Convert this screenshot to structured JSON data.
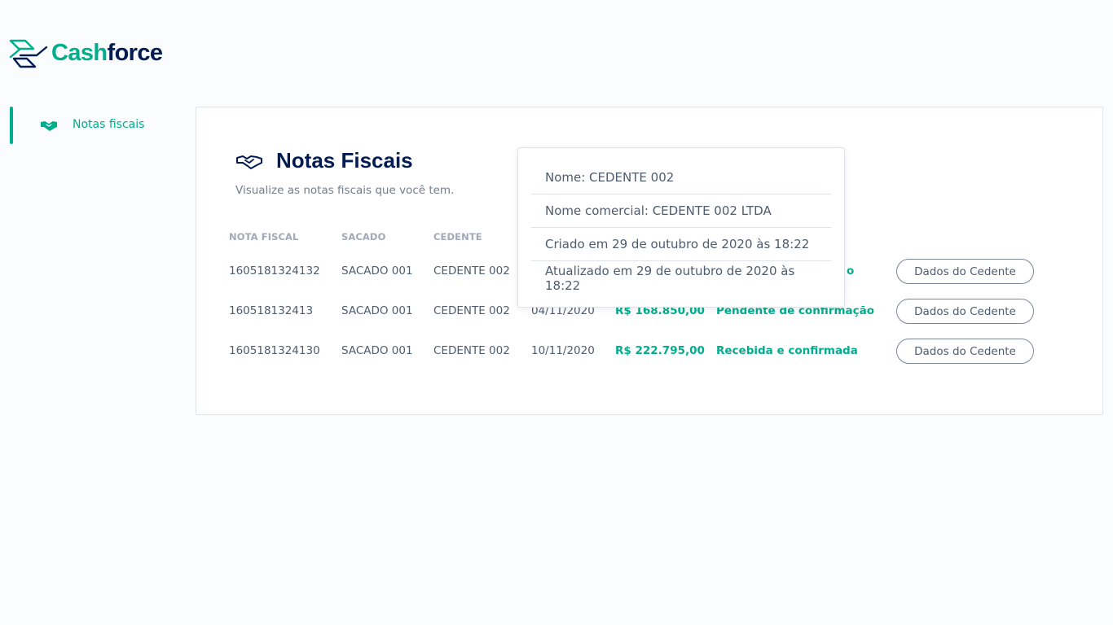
{
  "brand": {
    "name_part1": "Cash",
    "name_part2": "force"
  },
  "sidebar": {
    "items": [
      {
        "label": "Notas fiscais",
        "icon": "handshake-icon",
        "active": true
      }
    ]
  },
  "page": {
    "title": "Notas Fiscais",
    "subtitle": "Visualize as notas fiscais que você tem."
  },
  "table": {
    "headers": [
      "NOTA FISCAL",
      "SACADO",
      "CEDENTE"
    ],
    "rows": [
      {
        "nota": "1605181324132",
        "sacado": "SACADO 001",
        "cedente": "CEDENTE 002",
        "data": "",
        "valor": "",
        "status": "o",
        "action": "Dados do Cedente"
      },
      {
        "nota": "160518132413",
        "sacado": "SACADO 001",
        "cedente": "CEDENTE 002",
        "data": "04/11/2020",
        "valor": "R$ 168.850,00",
        "status": "Pendente de confirmação",
        "action": "Dados do Cedente"
      },
      {
        "nota": "1605181324130",
        "sacado": "SACADO 001",
        "cedente": "CEDENTE 002",
        "data": "10/11/2020",
        "valor": "R$ 222.795,00",
        "status": "Recebida e confirmada",
        "action": "Dados do Cedente"
      }
    ]
  },
  "popover": {
    "lines": [
      "Nome: CEDENTE 002",
      "Nome comercial: CEDENTE 002 LTDA",
      "Criado em 29 de outubro de 2020 às 18:22",
      "Atualizado em 29 de outubro de 2020 às 18:22"
    ]
  },
  "colors": {
    "accent": "#00ad8c",
    "navy": "#021b51",
    "text": "#4d5c6f",
    "muted": "#a1a9b8",
    "border": "#dfe2e8",
    "background": "#fbfcfe"
  }
}
